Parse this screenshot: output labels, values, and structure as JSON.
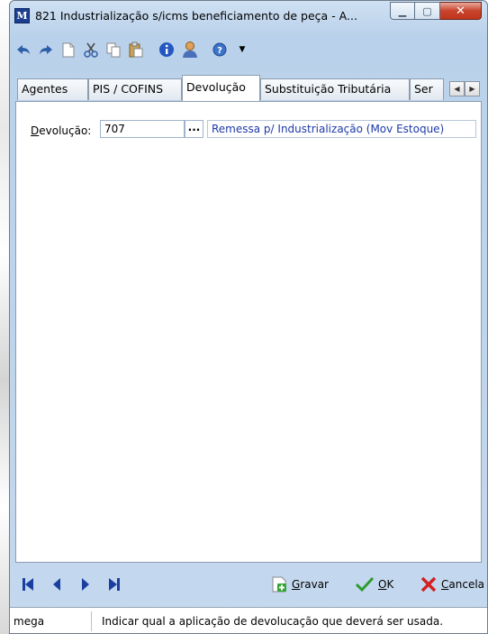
{
  "window": {
    "app_icon_letter": "M",
    "title": "821 Industrialização s/icms beneficiamento de peça - A..."
  },
  "toolbar": {
    "icons": [
      "undo-icon",
      "redo-icon",
      "new-document-icon",
      "cut-icon",
      "copy-icon",
      "paste-icon",
      "info-icon",
      "user-icon",
      "help-icon",
      "dropdown-icon"
    ]
  },
  "tabs": [
    {
      "label": "Agentes"
    },
    {
      "label": "PIS / COFINS"
    },
    {
      "label": "Devolução"
    },
    {
      "label": "Substituição Tributária"
    },
    {
      "label": "Ser"
    }
  ],
  "devolucao": {
    "label": "Devolução:",
    "code": "707",
    "lookup_label": "...",
    "description": "Remessa p/ Industrialização (Mov Estoque)"
  },
  "actions": {
    "save_label": "Gravar",
    "ok_label": "OK",
    "cancel_label": "Cancela"
  },
  "status": {
    "user": "mega",
    "message": "Indicar qual a aplicação de devolucação que deverá ser usada."
  },
  "colors": {
    "description_text": "#1d3aa8",
    "close_button": "#c8432c",
    "nav_arrows": "#1a3fa0",
    "ok_check": "#2e9b2e",
    "cancel_x": "#d42020"
  }
}
